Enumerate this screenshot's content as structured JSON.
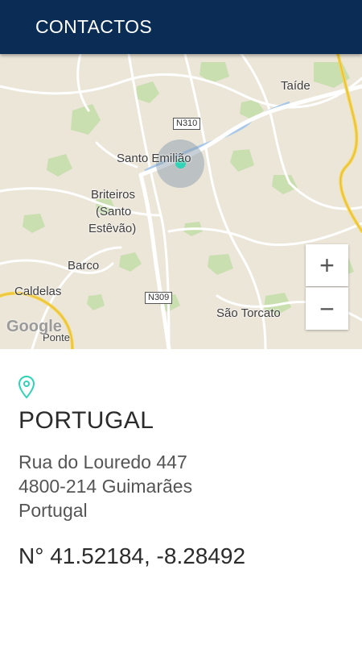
{
  "appbar": {
    "title": "CONTACTOS"
  },
  "map": {
    "places": {
      "taide": "Taíde",
      "santo_emiliao": "Santo Emilião",
      "briteiros_1": "Briteiros",
      "briteiros_2": "(Santo",
      "briteiros_3": "Estêvão)",
      "barco": "Barco",
      "caldelas": "Caldelas",
      "sao_torcato": "São Torcato",
      "ponte": "Ponte"
    },
    "roads": {
      "n310": "N310",
      "n309": "N309"
    },
    "zoom_in": "+",
    "zoom_out": "−",
    "attribution": "Google"
  },
  "contact": {
    "pin_icon": "map-pin-icon",
    "country": "PORTUGAL",
    "address_line1": "Rua do Louredo 447",
    "address_line2": "4800-214 Guimarães",
    "address_line3": "Portugal",
    "coordinates": "N° 41.52184, -8.28492"
  },
  "colors": {
    "appbar": "#0b2d55",
    "accent": "#2fd3b5"
  }
}
